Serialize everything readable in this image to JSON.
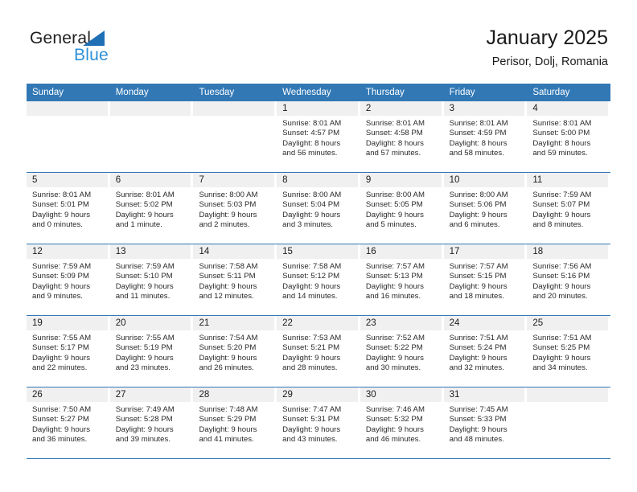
{
  "brand": {
    "name_top": "General",
    "name_bottom": "Blue",
    "accent_color": "#1f6fb4",
    "accent_light": "#2f8fd8"
  },
  "header": {
    "title": "January 2025",
    "subtitle": "Perisor, Dolj, Romania"
  },
  "theme": {
    "header_row_bg": "#3178b5",
    "daynum_bg": "#f0f0f0",
    "row_divider": "#3178b5",
    "text": "#1a1a1a"
  },
  "weekdays": [
    "Sunday",
    "Monday",
    "Tuesday",
    "Wednesday",
    "Thursday",
    "Friday",
    "Saturday"
  ],
  "weeks": [
    [
      {
        "empty": true,
        "day": ""
      },
      {
        "empty": true,
        "day": ""
      },
      {
        "empty": true,
        "day": ""
      },
      {
        "day": "1",
        "sunrise": "Sunrise: 8:01 AM",
        "sunset": "Sunset: 4:57 PM",
        "daylight1": "Daylight: 8 hours",
        "daylight2": "and 56 minutes."
      },
      {
        "day": "2",
        "sunrise": "Sunrise: 8:01 AM",
        "sunset": "Sunset: 4:58 PM",
        "daylight1": "Daylight: 8 hours",
        "daylight2": "and 57 minutes."
      },
      {
        "day": "3",
        "sunrise": "Sunrise: 8:01 AM",
        "sunset": "Sunset: 4:59 PM",
        "daylight1": "Daylight: 8 hours",
        "daylight2": "and 58 minutes."
      },
      {
        "day": "4",
        "sunrise": "Sunrise: 8:01 AM",
        "sunset": "Sunset: 5:00 PM",
        "daylight1": "Daylight: 8 hours",
        "daylight2": "and 59 minutes."
      }
    ],
    [
      {
        "day": "5",
        "sunrise": "Sunrise: 8:01 AM",
        "sunset": "Sunset: 5:01 PM",
        "daylight1": "Daylight: 9 hours",
        "daylight2": "and 0 minutes."
      },
      {
        "day": "6",
        "sunrise": "Sunrise: 8:01 AM",
        "sunset": "Sunset: 5:02 PM",
        "daylight1": "Daylight: 9 hours",
        "daylight2": "and 1 minute."
      },
      {
        "day": "7",
        "sunrise": "Sunrise: 8:00 AM",
        "sunset": "Sunset: 5:03 PM",
        "daylight1": "Daylight: 9 hours",
        "daylight2": "and 2 minutes."
      },
      {
        "day": "8",
        "sunrise": "Sunrise: 8:00 AM",
        "sunset": "Sunset: 5:04 PM",
        "daylight1": "Daylight: 9 hours",
        "daylight2": "and 3 minutes."
      },
      {
        "day": "9",
        "sunrise": "Sunrise: 8:00 AM",
        "sunset": "Sunset: 5:05 PM",
        "daylight1": "Daylight: 9 hours",
        "daylight2": "and 5 minutes."
      },
      {
        "day": "10",
        "sunrise": "Sunrise: 8:00 AM",
        "sunset": "Sunset: 5:06 PM",
        "daylight1": "Daylight: 9 hours",
        "daylight2": "and 6 minutes."
      },
      {
        "day": "11",
        "sunrise": "Sunrise: 7:59 AM",
        "sunset": "Sunset: 5:07 PM",
        "daylight1": "Daylight: 9 hours",
        "daylight2": "and 8 minutes."
      }
    ],
    [
      {
        "day": "12",
        "sunrise": "Sunrise: 7:59 AM",
        "sunset": "Sunset: 5:09 PM",
        "daylight1": "Daylight: 9 hours",
        "daylight2": "and 9 minutes."
      },
      {
        "day": "13",
        "sunrise": "Sunrise: 7:59 AM",
        "sunset": "Sunset: 5:10 PM",
        "daylight1": "Daylight: 9 hours",
        "daylight2": "and 11 minutes."
      },
      {
        "day": "14",
        "sunrise": "Sunrise: 7:58 AM",
        "sunset": "Sunset: 5:11 PM",
        "daylight1": "Daylight: 9 hours",
        "daylight2": "and 12 minutes."
      },
      {
        "day": "15",
        "sunrise": "Sunrise: 7:58 AM",
        "sunset": "Sunset: 5:12 PM",
        "daylight1": "Daylight: 9 hours",
        "daylight2": "and 14 minutes."
      },
      {
        "day": "16",
        "sunrise": "Sunrise: 7:57 AM",
        "sunset": "Sunset: 5:13 PM",
        "daylight1": "Daylight: 9 hours",
        "daylight2": "and 16 minutes."
      },
      {
        "day": "17",
        "sunrise": "Sunrise: 7:57 AM",
        "sunset": "Sunset: 5:15 PM",
        "daylight1": "Daylight: 9 hours",
        "daylight2": "and 18 minutes."
      },
      {
        "day": "18",
        "sunrise": "Sunrise: 7:56 AM",
        "sunset": "Sunset: 5:16 PM",
        "daylight1": "Daylight: 9 hours",
        "daylight2": "and 20 minutes."
      }
    ],
    [
      {
        "day": "19",
        "sunrise": "Sunrise: 7:55 AM",
        "sunset": "Sunset: 5:17 PM",
        "daylight1": "Daylight: 9 hours",
        "daylight2": "and 22 minutes."
      },
      {
        "day": "20",
        "sunrise": "Sunrise: 7:55 AM",
        "sunset": "Sunset: 5:19 PM",
        "daylight1": "Daylight: 9 hours",
        "daylight2": "and 23 minutes."
      },
      {
        "day": "21",
        "sunrise": "Sunrise: 7:54 AM",
        "sunset": "Sunset: 5:20 PM",
        "daylight1": "Daylight: 9 hours",
        "daylight2": "and 26 minutes."
      },
      {
        "day": "22",
        "sunrise": "Sunrise: 7:53 AM",
        "sunset": "Sunset: 5:21 PM",
        "daylight1": "Daylight: 9 hours",
        "daylight2": "and 28 minutes."
      },
      {
        "day": "23",
        "sunrise": "Sunrise: 7:52 AM",
        "sunset": "Sunset: 5:22 PM",
        "daylight1": "Daylight: 9 hours",
        "daylight2": "and 30 minutes."
      },
      {
        "day": "24",
        "sunrise": "Sunrise: 7:51 AM",
        "sunset": "Sunset: 5:24 PM",
        "daylight1": "Daylight: 9 hours",
        "daylight2": "and 32 minutes."
      },
      {
        "day": "25",
        "sunrise": "Sunrise: 7:51 AM",
        "sunset": "Sunset: 5:25 PM",
        "daylight1": "Daylight: 9 hours",
        "daylight2": "and 34 minutes."
      }
    ],
    [
      {
        "day": "26",
        "sunrise": "Sunrise: 7:50 AM",
        "sunset": "Sunset: 5:27 PM",
        "daylight1": "Daylight: 9 hours",
        "daylight2": "and 36 minutes."
      },
      {
        "day": "27",
        "sunrise": "Sunrise: 7:49 AM",
        "sunset": "Sunset: 5:28 PM",
        "daylight1": "Daylight: 9 hours",
        "daylight2": "and 39 minutes."
      },
      {
        "day": "28",
        "sunrise": "Sunrise: 7:48 AM",
        "sunset": "Sunset: 5:29 PM",
        "daylight1": "Daylight: 9 hours",
        "daylight2": "and 41 minutes."
      },
      {
        "day": "29",
        "sunrise": "Sunrise: 7:47 AM",
        "sunset": "Sunset: 5:31 PM",
        "daylight1": "Daylight: 9 hours",
        "daylight2": "and 43 minutes."
      },
      {
        "day": "30",
        "sunrise": "Sunrise: 7:46 AM",
        "sunset": "Sunset: 5:32 PM",
        "daylight1": "Daylight: 9 hours",
        "daylight2": "and 46 minutes."
      },
      {
        "day": "31",
        "sunrise": "Sunrise: 7:45 AM",
        "sunset": "Sunset: 5:33 PM",
        "daylight1": "Daylight: 9 hours",
        "daylight2": "and 48 minutes."
      },
      {
        "empty": true,
        "day": ""
      }
    ]
  ]
}
